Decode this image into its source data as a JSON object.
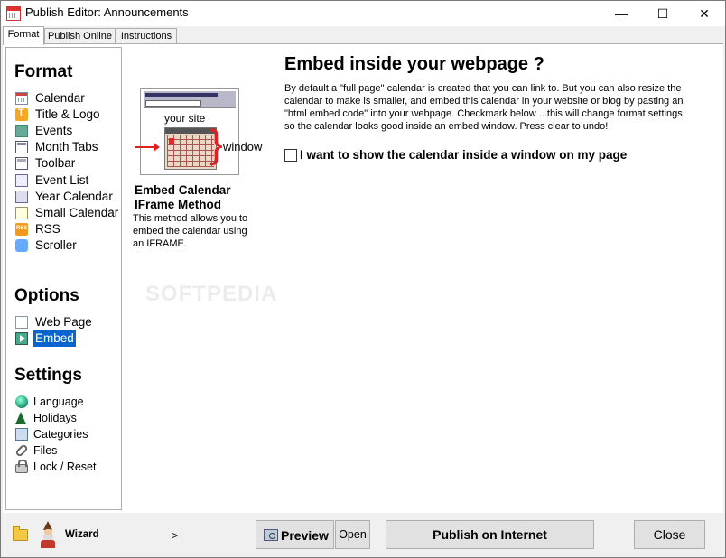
{
  "window": {
    "title": "Publish Editor: Announcements",
    "minimize": "—",
    "maximize": "☐",
    "close": "✕"
  },
  "tabs": [
    "Format",
    "Publish Online",
    "Instructions"
  ],
  "sidebar": {
    "format_title": "Format",
    "format_items": [
      {
        "label": "Calendar",
        "icon": "calendar-icon"
      },
      {
        "label": "Title & Logo",
        "icon": "title-logo-icon"
      },
      {
        "label": "Events",
        "icon": "events-icon"
      },
      {
        "label": "Month Tabs",
        "icon": "month-tabs-icon"
      },
      {
        "label": "Toolbar",
        "icon": "toolbar-icon"
      },
      {
        "label": "Event List",
        "icon": "event-list-icon"
      },
      {
        "label": "Year Calendar",
        "icon": "year-calendar-icon"
      },
      {
        "label": "Small Calendar",
        "icon": "small-calendar-icon"
      },
      {
        "label": "RSS",
        "icon": "rss-icon"
      },
      {
        "label": "Scroller",
        "icon": "scroller-icon"
      }
    ],
    "options_title": "Options",
    "options_items": [
      {
        "label": "Web Page",
        "icon": "web-page-icon"
      },
      {
        "label": "Embed",
        "icon": "embed-icon",
        "selected": true
      }
    ],
    "settings_title": "Settings",
    "settings_items": [
      {
        "label": "Language",
        "icon": "globe-icon"
      },
      {
        "label": "Holidays",
        "icon": "tree-icon"
      },
      {
        "label": "Categories",
        "icon": "categories-icon"
      },
      {
        "label": "Files",
        "icon": "paperclip-icon"
      },
      {
        "label": "Lock / Reset",
        "icon": "lock-icon"
      }
    ]
  },
  "preview": {
    "your_site": "your site",
    "window_label": "window"
  },
  "method": {
    "title": "Embed Calendar\nIFrame Method",
    "description": "This method allows you to embed the calendar using an IFRAME."
  },
  "main": {
    "heading": "Embed inside your webpage ?",
    "paragraph": "By default a \"full page\" calendar is created that you can link to.  But you can also resize the calendar to make is smaller, and embed this calendar in your website or blog by pasting an \"html embed code\" into your webpage. Checkmark below ...this will change format settings so the calendar looks good inside an embed window.  Press clear to undo!",
    "checkbox_label": "I want to show the calendar inside a window on my page",
    "checkbox_checked": false
  },
  "watermark": "SOFTPEDIA",
  "bottom": {
    "wizard_label": "Wizard",
    "wizard_arrow": ">",
    "preview_label": "Preview",
    "open_label": "Open",
    "publish_label": "Publish on Internet",
    "close_label": "Close"
  },
  "colors": {
    "selection": "#0a64ce",
    "accent_red": "#d22222"
  }
}
